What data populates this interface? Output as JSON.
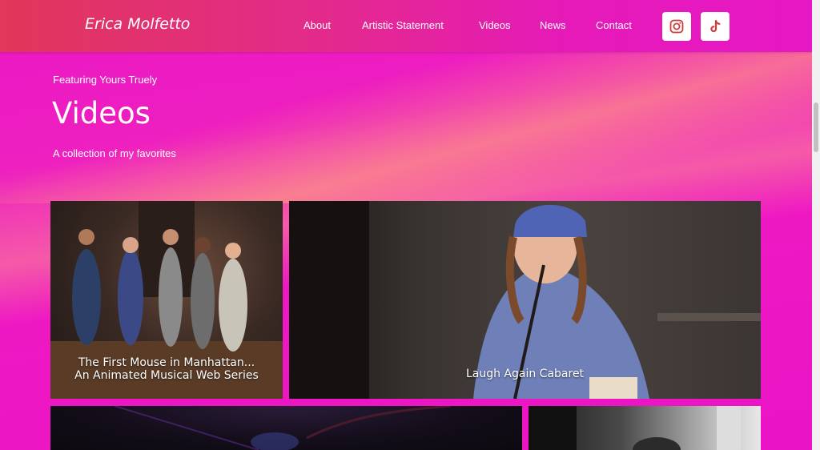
{
  "header": {
    "brand": "Erica Molfetto",
    "nav": [
      "About",
      "Artistic Statement",
      "Videos",
      "News",
      "Contact"
    ],
    "social": [
      {
        "icon": "instagram-icon"
      },
      {
        "icon": "tiktok-icon"
      }
    ]
  },
  "hero": {
    "kicker": "Featuring Yours Truely",
    "title": "Videos",
    "subtitle": "A collection of my favorites"
  },
  "videos": [
    {
      "line1": "The First Mouse in Manhattan...",
      "line2": "An Animated Musical Web Series"
    },
    {
      "line1": "Laugh Again Cabaret",
      "line2": ""
    }
  ],
  "colors": {
    "accent_pink": "#ec16c4",
    "header_red": "#e0375a",
    "icon_red": "#d43a3a"
  }
}
